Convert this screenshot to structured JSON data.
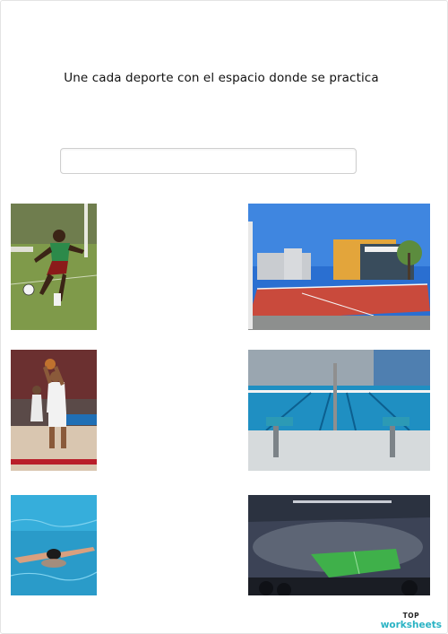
{
  "worksheet": {
    "instruction": "Une cada deporte con el espacio donde se practica",
    "answer_value": ""
  },
  "images": [
    {
      "name": "soccer-player-photo",
      "icon": "football-player-image"
    },
    {
      "name": "outdoor-court-photo",
      "icon": "sports-court-image"
    },
    {
      "name": "basketball-player-photo",
      "icon": "basketball-player-image"
    },
    {
      "name": "swimming-pool-photo",
      "icon": "pool-image"
    },
    {
      "name": "swimmer-photo",
      "icon": "swimmer-image"
    },
    {
      "name": "stadium-photo",
      "icon": "stadium-image"
    }
  ],
  "logo": {
    "top": "TOP",
    "bottom": "worksheets"
  }
}
